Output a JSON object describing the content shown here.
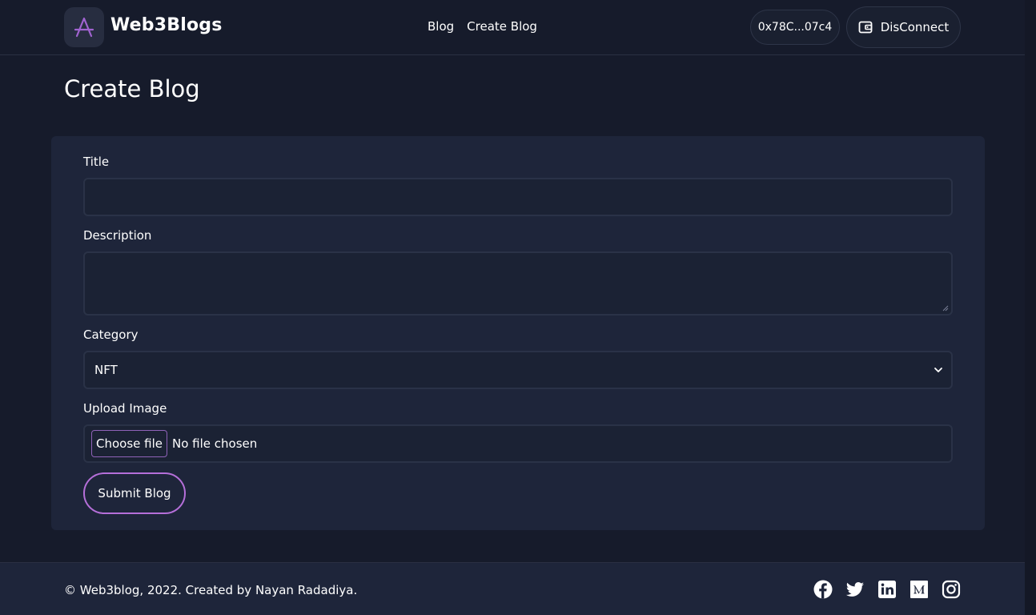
{
  "header": {
    "brand": "Web3Blogs",
    "nav": [
      {
        "label": "Blog"
      },
      {
        "label": "Create Blog"
      }
    ],
    "wallet_address": "0x78C...07c4",
    "disconnect_label": "DisConnect"
  },
  "page": {
    "title": "Create Blog"
  },
  "form": {
    "title_label": "Title",
    "title_value": "",
    "description_label": "Description",
    "description_value": "",
    "category_label": "Category",
    "category_selected": "NFT",
    "image_label": "Upload Image",
    "choose_file_label": "Choose file",
    "file_status": "No file chosen",
    "submit_label": "Submit Blog"
  },
  "footer": {
    "copyright": "© Web3blog, 2022. Created by Nayan Radadiya.",
    "socials": [
      "facebook-icon",
      "twitter-icon",
      "linkedin-icon",
      "medium-icon",
      "instagram-icon"
    ]
  },
  "colors": {
    "background": "#161b2b",
    "card": "#1e253a",
    "accent": "#b56fd9"
  }
}
